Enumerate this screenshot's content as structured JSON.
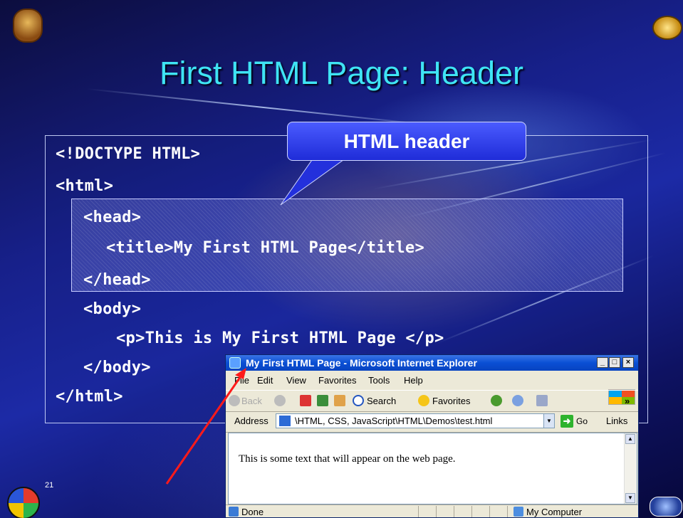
{
  "slide": {
    "title": "First HTML Page: Header",
    "page_number": "21",
    "callout_label": "HTML header",
    "code_lines": [
      "<!DOCTYPE HTML>",
      "<html>",
      "<head>",
      "<title>My First HTML Page</title>",
      "</head>",
      "<body>",
      "<p>This is My First HTML Page </p>",
      "</body>",
      "</html>"
    ],
    "colors": {
      "title": "#3fe4f4",
      "background": "#17208a",
      "callout": "#2a3ae8"
    }
  },
  "browser": {
    "window_title": "My First HTML Page - Microsoft Internet Explorer",
    "menu": [
      "File",
      "Edit",
      "View",
      "Favorites",
      "Tools",
      "Help"
    ],
    "toolbar": {
      "back": "Back",
      "search": "Search",
      "favorites": "Favorites",
      "overflow": "»"
    },
    "address": {
      "label": "Address",
      "value": "\\HTML, CSS, JavaScript\\HTML\\Demos\\test.html",
      "go": "Go",
      "links": "Links"
    },
    "content_text": "This is some text that will appear on the web page.",
    "status": {
      "left": "Done",
      "zone": "My Computer"
    }
  }
}
